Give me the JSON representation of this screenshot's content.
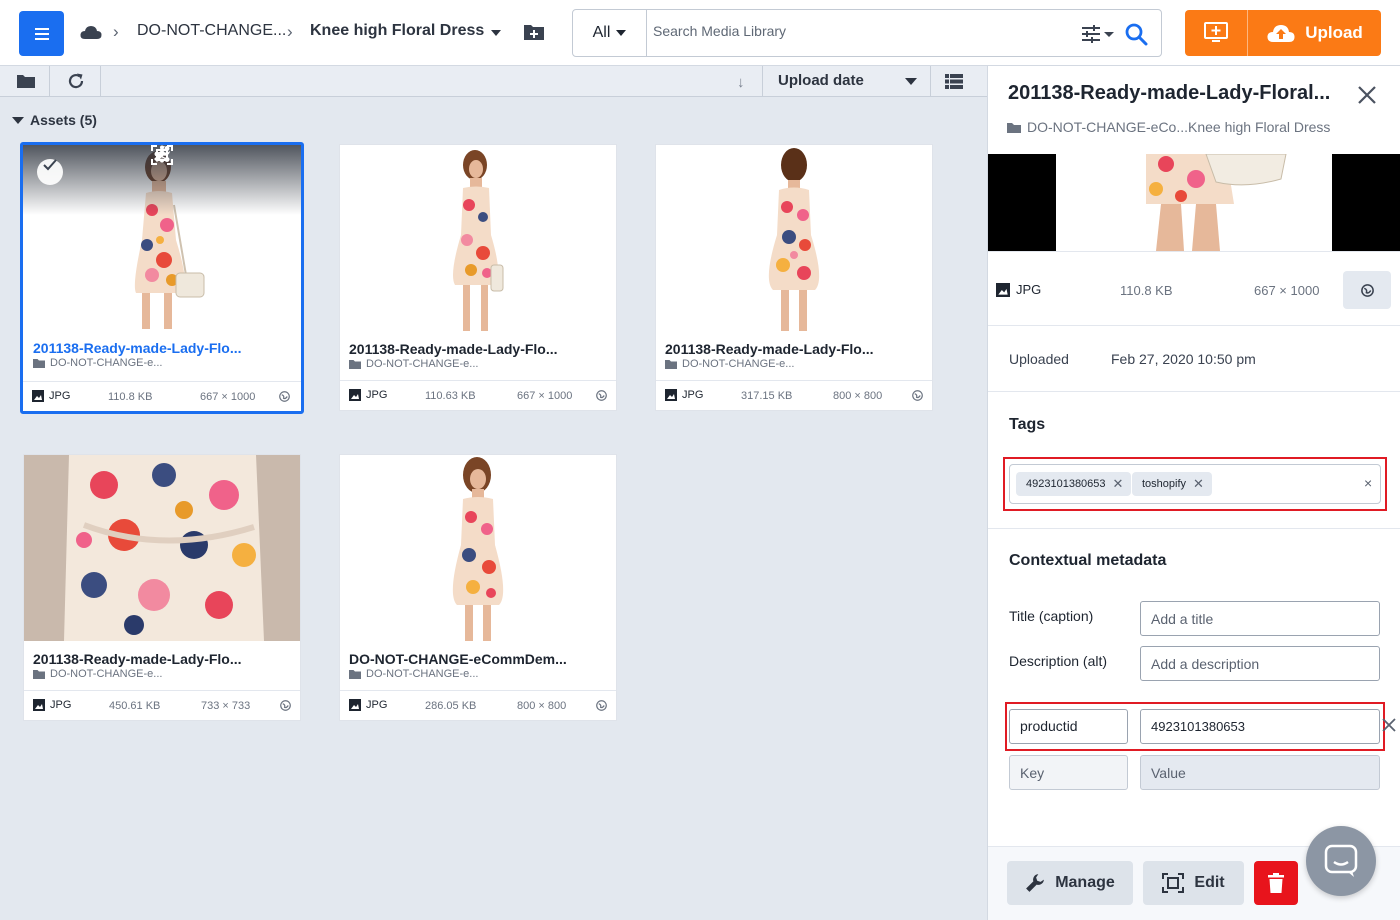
{
  "breadcrumb": {
    "root": "DO-NOT-CHANGE...",
    "current": "Knee high Floral Dress"
  },
  "search": {
    "scope": "All",
    "placeholder": "Search Media Library"
  },
  "upload": {
    "label": "Upload"
  },
  "toolbar": {
    "sort_label": "Upload date",
    "sort_direction": "↓"
  },
  "assets": {
    "header": "Assets (5)",
    "items": [
      {
        "title": "201138-Ready-made-Lady-Flo...",
        "folder": "DO-NOT-CHANGE-e...",
        "type": "JPG",
        "size": "110.8 KB",
        "dims": "667 × 1000",
        "selected": true
      },
      {
        "title": "201138-Ready-made-Lady-Flo...",
        "folder": "DO-NOT-CHANGE-e...",
        "type": "JPG",
        "size": "110.63 KB",
        "dims": "667 × 1000",
        "selected": false
      },
      {
        "title": "201138-Ready-made-Lady-Flo...",
        "folder": "DO-NOT-CHANGE-e...",
        "type": "JPG",
        "size": "317.15 KB",
        "dims": "800 × 800",
        "selected": false
      },
      {
        "title": "201138-Ready-made-Lady-Flo...",
        "folder": "DO-NOT-CHANGE-e...",
        "type": "JPG",
        "size": "450.61 KB",
        "dims": "733 × 733",
        "selected": false
      },
      {
        "title": "DO-NOT-CHANGE-eCommDem...",
        "folder": "DO-NOT-CHANGE-e...",
        "type": "JPG",
        "size": "286.05 KB",
        "dims": "800 × 800",
        "selected": false
      }
    ]
  },
  "panel": {
    "title": "201138-Ready-made-Lady-Floral...",
    "path": "DO-NOT-CHANGE-eCo...Knee high Floral Dress",
    "type": "JPG",
    "size": "110.8 KB",
    "dims": "667 × 1000",
    "uploaded_label": "Uploaded",
    "uploaded_value": "Feb 27, 2020 10:50 pm",
    "tags_title": "Tags",
    "tags": [
      "4923101380653",
      "toshopify"
    ],
    "tags_clear": "×",
    "ctx_title": "Contextual metadata",
    "title_label": "Title (caption)",
    "title_placeholder": "Add a title",
    "desc_label": "Description (alt)",
    "desc_placeholder": "Add a description",
    "kv": {
      "key": "productid",
      "value": "4923101380653"
    },
    "key_placeholder": "Key",
    "value_placeholder": "Value",
    "manage_label": "Manage",
    "edit_label": "Edit"
  },
  "colors": {
    "accent": "#1a6ef0",
    "upload": "#fb7a15",
    "danger": "#e8141c",
    "highlight": "#e01b24"
  }
}
